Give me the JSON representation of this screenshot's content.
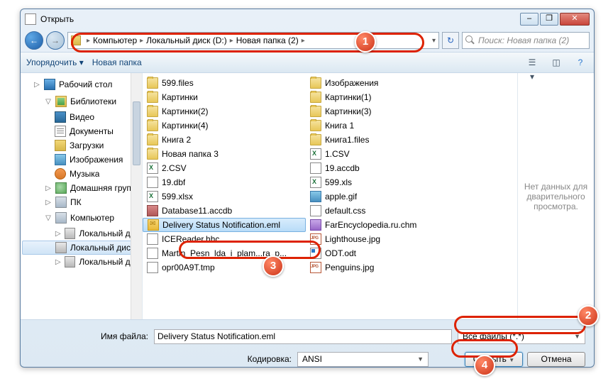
{
  "window": {
    "title": "Открыть"
  },
  "breadcrumb": {
    "root": "Компьютер",
    "seg1": "Локальный диск (D:)",
    "seg2": "Новая папка (2)"
  },
  "search": {
    "placeholder": "Поиск: Новая папка (2)"
  },
  "toolbar": {
    "organize": "Упорядочить ▾",
    "newfolder": "Новая папка"
  },
  "nav": {
    "desktop": "Рабочий стол",
    "libraries": "Библиотеки",
    "video": "Видео",
    "documents": "Документы",
    "downloads": "Загрузки",
    "images": "Изображения",
    "music": "Музыка",
    "homegroup": "Домашняя группа",
    "pc": "ПК",
    "computer": "Компьютер",
    "local1": "Локальный дис...",
    "local2": "Локальный дис...",
    "local3": "Локальный дис..."
  },
  "files": {
    "c1": [
      "599.files",
      "Картинки",
      "Картинки(2)",
      "Картинки(4)",
      "Книга 2",
      "Новая папка 3",
      "2.CSV",
      "19.dbf",
      "599.xlsx",
      "Database11.accdb",
      "Delivery Status Notification.eml",
      "ICEReader.hhc",
      "Martin_Pesn_lda_i_plam...ra_p...",
      "opr00A9T.tmp"
    ],
    "c2": [
      "Изображения",
      "Картинки(1)",
      "Картинки(3)",
      "Книга 1",
      "Книга1.files",
      "1.CSV",
      "19.accdb",
      "599.xls",
      "apple.gif",
      "default.css",
      "FarEncyclopedia.ru.chm",
      "Lighthouse.jpg",
      "ODT.odt",
      "Penguins.jpg"
    ]
  },
  "icons": {
    "c1": [
      "folder",
      "folder",
      "folder",
      "folder",
      "folder",
      "folder",
      "xls",
      "file",
      "xls",
      "db",
      "eml",
      "file",
      "file",
      "file"
    ],
    "c2": [
      "folder",
      "folder",
      "folder",
      "folder",
      "folder",
      "xls",
      "file",
      "xls",
      "gif",
      "css",
      "chm",
      "jpg",
      "odt",
      "jpg"
    ]
  },
  "preview": {
    "empty": "Нет данных для дварительного просмотра."
  },
  "bottom": {
    "fnlabel": "Имя файла:",
    "fnvalue": "Delivery Status Notification.eml",
    "filter": "Все файлы (*.*)",
    "enclabel": "Кодировка:",
    "encvalue": "ANSI",
    "open": "Открыть",
    "cancel": "Отмена"
  },
  "callouts": {
    "c1": "1",
    "c2": "2",
    "c3": "3",
    "c4": "4"
  }
}
